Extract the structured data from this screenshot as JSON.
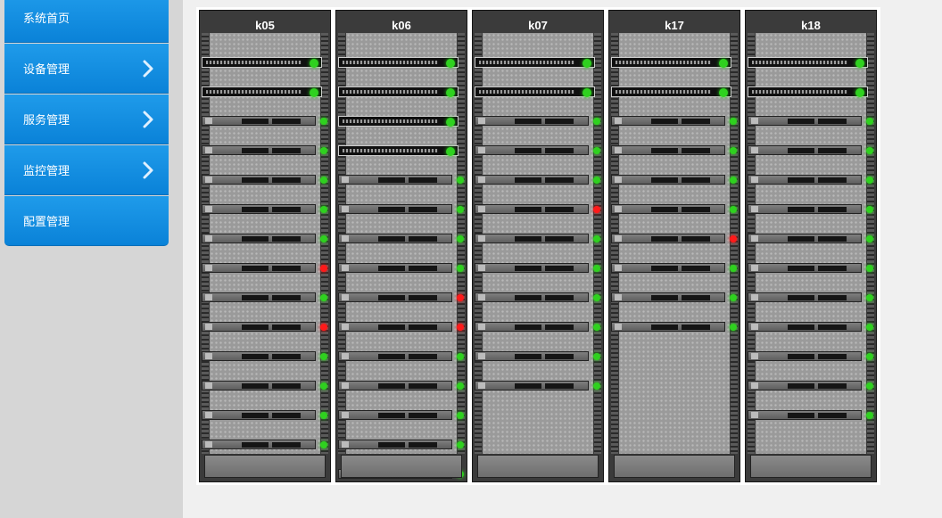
{
  "menu": {
    "items": [
      {
        "label": "系统首页",
        "has_arrow": false
      },
      {
        "label": "设备管理",
        "has_arrow": true
      },
      {
        "label": "服务管理",
        "has_arrow": true
      },
      {
        "label": "监控管理",
        "has_arrow": true
      },
      {
        "label": "配置管理",
        "has_arrow": false
      }
    ]
  },
  "colors": {
    "menu_blue": "#0a82d8",
    "status_ok": "#2fd11f",
    "status_alarm": "#ff1a1a"
  },
  "racks": [
    {
      "name": "k05",
      "units": [
        {
          "type": "switch",
          "status": "ok"
        },
        {
          "type": "switch",
          "status": "ok"
        },
        {
          "type": "server",
          "status": "ok"
        },
        {
          "type": "server",
          "status": "ok"
        },
        {
          "type": "server",
          "status": "ok"
        },
        {
          "type": "server",
          "status": "ok"
        },
        {
          "type": "server",
          "status": "ok"
        },
        {
          "type": "server",
          "status": "alarm"
        },
        {
          "type": "server",
          "status": "ok"
        },
        {
          "type": "server",
          "status": "alarm"
        },
        {
          "type": "server",
          "status": "ok"
        },
        {
          "type": "server",
          "status": "ok"
        },
        {
          "type": "server",
          "status": "ok"
        },
        {
          "type": "server",
          "status": "ok"
        }
      ]
    },
    {
      "name": "k06",
      "units": [
        {
          "type": "switch",
          "status": "ok"
        },
        {
          "type": "switch",
          "status": "ok"
        },
        {
          "type": "switch",
          "status": "ok"
        },
        {
          "type": "switch",
          "status": "ok"
        },
        {
          "type": "server",
          "status": "ok"
        },
        {
          "type": "server",
          "status": "ok"
        },
        {
          "type": "server",
          "status": "ok"
        },
        {
          "type": "server",
          "status": "ok"
        },
        {
          "type": "server",
          "status": "alarm"
        },
        {
          "type": "server",
          "status": "alarm"
        },
        {
          "type": "server",
          "status": "ok"
        },
        {
          "type": "server",
          "status": "ok"
        },
        {
          "type": "server",
          "status": "ok"
        },
        {
          "type": "server",
          "status": "ok"
        },
        {
          "type": "server",
          "status": "ok"
        }
      ]
    },
    {
      "name": "k07",
      "units": [
        {
          "type": "switch",
          "status": "ok"
        },
        {
          "type": "switch",
          "status": "ok"
        },
        {
          "type": "server",
          "status": "ok"
        },
        {
          "type": "server",
          "status": "ok"
        },
        {
          "type": "server",
          "status": "ok"
        },
        {
          "type": "server",
          "status": "alarm"
        },
        {
          "type": "server",
          "status": "ok"
        },
        {
          "type": "server",
          "status": "ok"
        },
        {
          "type": "server",
          "status": "ok"
        },
        {
          "type": "server",
          "status": "ok"
        },
        {
          "type": "server",
          "status": "ok"
        },
        {
          "type": "server",
          "status": "ok"
        }
      ]
    },
    {
      "name": "k17",
      "units": [
        {
          "type": "switch",
          "status": "ok"
        },
        {
          "type": "switch",
          "status": "ok"
        },
        {
          "type": "server",
          "status": "ok"
        },
        {
          "type": "server",
          "status": "ok"
        },
        {
          "type": "server",
          "status": "ok"
        },
        {
          "type": "server",
          "status": "ok"
        },
        {
          "type": "server",
          "status": "alarm"
        },
        {
          "type": "server",
          "status": "ok"
        },
        {
          "type": "server",
          "status": "ok"
        },
        {
          "type": "server",
          "status": "ok"
        }
      ]
    },
    {
      "name": "k18",
      "units": [
        {
          "type": "switch",
          "status": "ok"
        },
        {
          "type": "switch",
          "status": "ok"
        },
        {
          "type": "server",
          "status": "ok"
        },
        {
          "type": "server",
          "status": "ok"
        },
        {
          "type": "server",
          "status": "ok"
        },
        {
          "type": "server",
          "status": "ok"
        },
        {
          "type": "server",
          "status": "ok"
        },
        {
          "type": "server",
          "status": "ok"
        },
        {
          "type": "server",
          "status": "ok"
        },
        {
          "type": "server",
          "status": "ok"
        },
        {
          "type": "server",
          "status": "ok"
        },
        {
          "type": "server",
          "status": "ok"
        },
        {
          "type": "server",
          "status": "ok"
        }
      ]
    }
  ]
}
